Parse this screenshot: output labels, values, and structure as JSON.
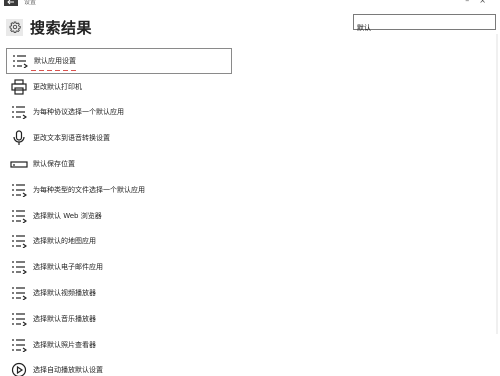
{
  "window": {
    "title": "设置"
  },
  "header": {
    "title": "搜索结果",
    "icon": "gear-icon"
  },
  "search": {
    "value": "默认",
    "placeholder": ""
  },
  "results": [
    {
      "label": "默认应用设置",
      "icon": "list-arrow-icon",
      "selected": true
    },
    {
      "label": "更改默认打印机",
      "icon": "printer-icon",
      "selected": false
    },
    {
      "label": "为每种协议选择一个默认应用",
      "icon": "list-arrow-icon",
      "selected": false
    },
    {
      "label": "更改文本到语音转换设置",
      "icon": "microphone-icon",
      "selected": false
    },
    {
      "label": "默认保存位置",
      "icon": "drive-icon",
      "selected": false
    },
    {
      "label": "为每种类型的文件选择一个默认应用",
      "icon": "list-arrow-icon",
      "selected": false
    },
    {
      "label": "选择默认 Web 浏览器",
      "icon": "list-arrow-icon",
      "selected": false
    },
    {
      "label": "选择默认的地图应用",
      "icon": "list-arrow-icon",
      "selected": false
    },
    {
      "label": "选择默认电子邮件应用",
      "icon": "list-arrow-icon",
      "selected": false
    },
    {
      "label": "选择默认视频播放器",
      "icon": "list-arrow-icon",
      "selected": false
    },
    {
      "label": "选择默认音乐播放器",
      "icon": "list-arrow-icon",
      "selected": false
    },
    {
      "label": "选择默认照片查看器",
      "icon": "list-arrow-icon",
      "selected": false
    },
    {
      "label": "选择自动播放默认设置",
      "icon": "autoplay-icon",
      "selected": false
    }
  ]
}
